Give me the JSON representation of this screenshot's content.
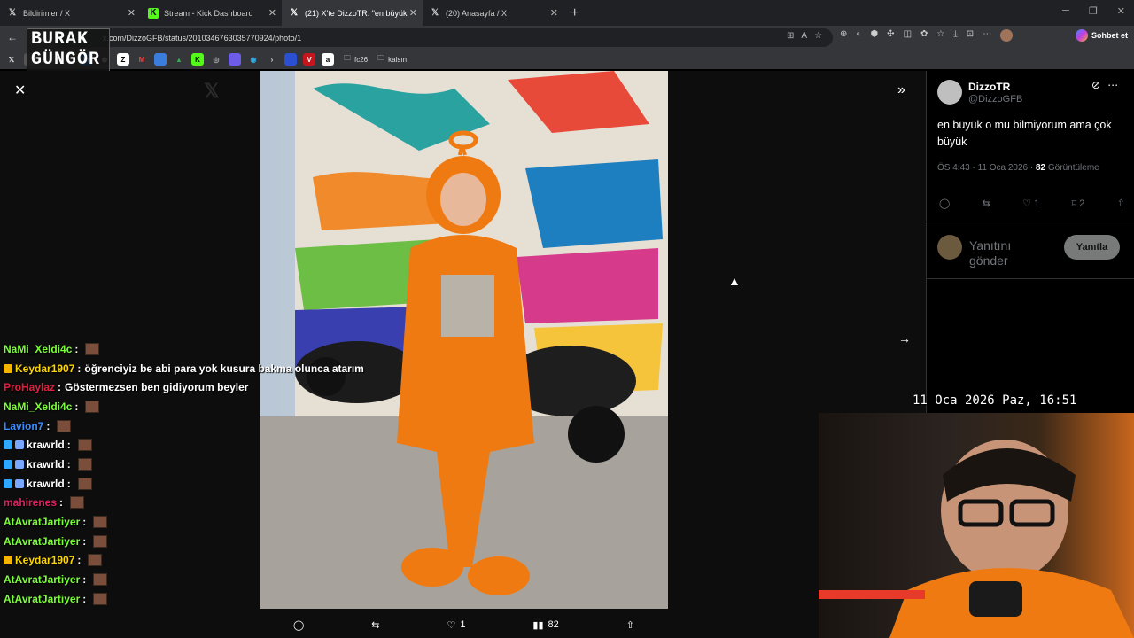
{
  "browser": {
    "tabs": [
      {
        "label": "Bildirimler / X",
        "icon": "x-logo-icon",
        "active": false
      },
      {
        "label": "Stream - Kick Dashboard",
        "icon": "kick-logo-icon",
        "active": false
      },
      {
        "label": "(21) X'te DizzoTR: \"en büyük o mu",
        "icon": "x-logo-icon",
        "active": true
      },
      {
        "label": "(20) Anasayfa / X",
        "icon": "x-logo-icon",
        "active": false
      }
    ],
    "url": "x.com/DizzoGFB/status/2010346763035770924/photo/1",
    "copilot_label": "Sohbet et",
    "bookmark_folders": [
      "fc26",
      "kalsın"
    ]
  },
  "overlay": {
    "streamer_logo_line1": "BURAK",
    "streamer_logo_line2": "GÜNGÖR",
    "clock": "11 Oca 2026 Paz, 16:51"
  },
  "chat": [
    {
      "user": "NaMi_Xeldi4c",
      "text": "",
      "color": "#7cfc3a",
      "badges": [],
      "emote": true
    },
    {
      "user": "Keydar1907",
      "text": "öğrenciyiz be abi para yok kusura bakma olunca atarım",
      "color": "#ffd700",
      "badges": [
        "crown"
      ],
      "emote": false
    },
    {
      "user": "ProHaylaz",
      "text": "Göstermezsen ben gidiyorum beyler",
      "color": "#e02040",
      "badges": [],
      "emote": false
    },
    {
      "user": "NaMi_Xeldi4c",
      "text": "",
      "color": "#7cfc3a",
      "badges": [],
      "emote": true
    },
    {
      "user": "Lavion7",
      "text": "",
      "color": "#3a8cff",
      "badges": [],
      "emote": true
    },
    {
      "user": "krawrld",
      "text": "",
      "color": "#ffffff",
      "badges": [
        "gem",
        "globe"
      ],
      "emote": true
    },
    {
      "user": "krawrld",
      "text": "",
      "color": "#ffffff",
      "badges": [
        "gem",
        "globe"
      ],
      "emote": true
    },
    {
      "user": "krawrld",
      "text": "",
      "color": "#ffffff",
      "badges": [
        "gem",
        "globe"
      ],
      "emote": true
    },
    {
      "user": "mahirenes",
      "text": "",
      "color": "#e02060",
      "badges": [],
      "emote": true
    },
    {
      "user": "AtAvratJartiyer",
      "text": "",
      "color": "#7cfc3a",
      "badges": [],
      "emote": true
    },
    {
      "user": "AtAvratJartiyer",
      "text": "",
      "color": "#7cfc3a",
      "badges": [],
      "emote": true
    },
    {
      "user": "Keydar1907",
      "text": "",
      "color": "#ffd700",
      "badges": [
        "crown"
      ],
      "emote": true
    },
    {
      "user": "AtAvratJartiyer",
      "text": "",
      "color": "#7cfc3a",
      "badges": [],
      "emote": true
    },
    {
      "user": "AtAvratJartiyer",
      "text": "",
      "color": "#7cfc3a",
      "badges": [],
      "emote": true
    }
  ],
  "photo_actions": {
    "likes": "1",
    "views": "82"
  },
  "post": {
    "display_name": "DizzoTR",
    "handle": "@DizzoGFB",
    "text": "en büyük o mu bilmiyorum ama çok büyük",
    "time": "ÖS 4:43 · 11 Oca 2026 ·",
    "views_count": "82",
    "views_label": "Görüntüleme",
    "likes": "1",
    "bookmarks": "2",
    "reply_placeholder": "Yanıtını gönder",
    "reply_button": "Yanıtla"
  },
  "colors": {
    "accent": "#1d9bf0",
    "suit_orange": "#f07a12"
  }
}
